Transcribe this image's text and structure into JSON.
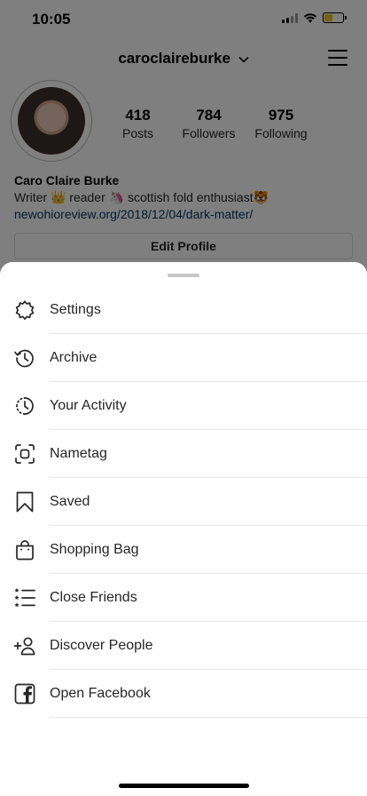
{
  "status": {
    "time": "10:05"
  },
  "profile": {
    "username": "caroclaireburke",
    "stats": [
      {
        "value": "418",
        "label": "Posts"
      },
      {
        "value": "784",
        "label": "Followers"
      },
      {
        "value": "975",
        "label": "Following"
      }
    ],
    "name": "Caro Claire Burke",
    "bio": "Writer 👑 reader 🦄 scottish fold enthusiast🐯",
    "link": "newohioreview.org/2018/12/04/dark-matter/",
    "edit_button": "Edit Profile"
  },
  "menu": {
    "items": [
      {
        "label": "Settings",
        "icon": "settings-icon"
      },
      {
        "label": "Archive",
        "icon": "archive-icon"
      },
      {
        "label": "Your Activity",
        "icon": "activity-icon"
      },
      {
        "label": "Nametag",
        "icon": "nametag-icon"
      },
      {
        "label": "Saved",
        "icon": "bookmark-icon"
      },
      {
        "label": "Shopping Bag",
        "icon": "shopping-bag-icon"
      },
      {
        "label": "Close Friends",
        "icon": "close-friends-icon"
      },
      {
        "label": "Discover People",
        "icon": "add-person-icon"
      },
      {
        "label": "Open Facebook",
        "icon": "facebook-icon"
      }
    ]
  },
  "colors": {
    "link": "#003569",
    "battery": "#f5c518",
    "overlay": "rgba(0,0,0,0.5)"
  }
}
